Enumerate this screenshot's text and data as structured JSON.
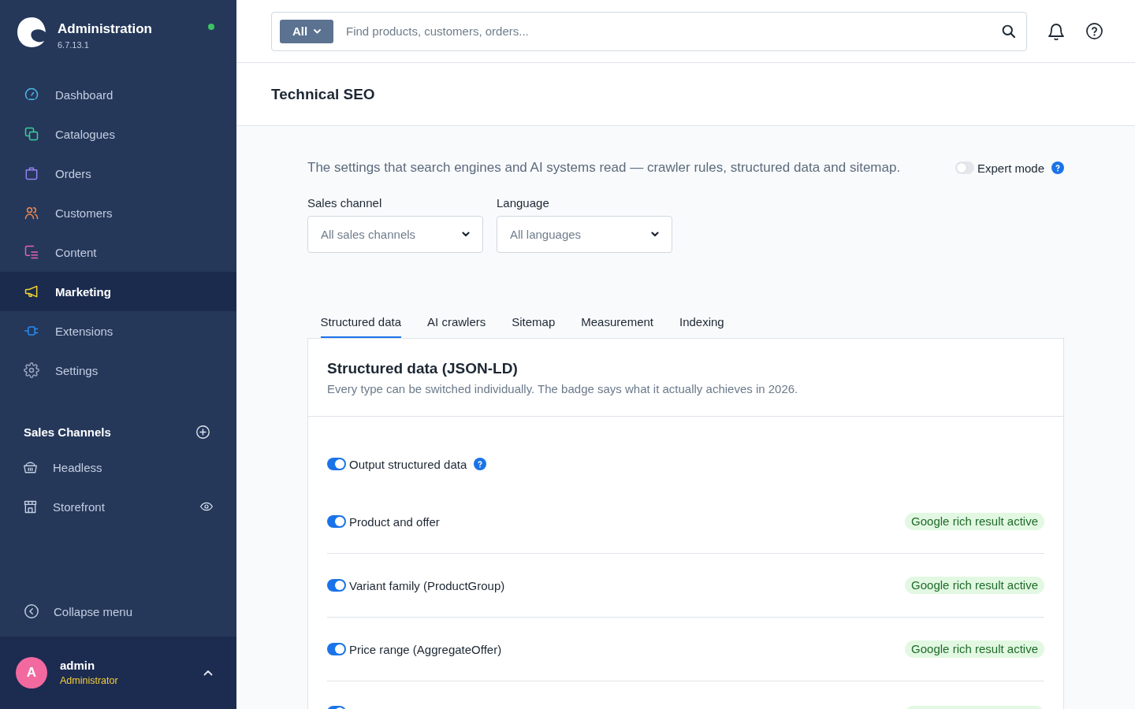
{
  "sidebar": {
    "app": {
      "title": "Administration",
      "version": "6.7.13.1",
      "online": true
    },
    "nav": [
      {
        "label": "Dashboard",
        "color": "#4db8e8",
        "selected": false
      },
      {
        "label": "Catalogues",
        "color": "#3ccf9a",
        "selected": false
      },
      {
        "label": "Orders",
        "color": "#9382f0",
        "selected": false
      },
      {
        "label": "Customers",
        "color": "#f2884b",
        "selected": false
      },
      {
        "label": "Content",
        "color": "#e860b4",
        "selected": false
      },
      {
        "label": "Marketing",
        "color": "#f2d230",
        "selected": true
      },
      {
        "label": "Extensions",
        "color": "#2a8cf0",
        "selected": false
      },
      {
        "label": "Settings",
        "color": "#9aa6bd",
        "selected": false
      }
    ],
    "sales_channels": {
      "heading": "Sales Channels",
      "items": [
        {
          "label": "Headless",
          "preview": false
        },
        {
          "label": "Storefront",
          "preview": true
        }
      ]
    },
    "collapse": "Collapse menu",
    "user": {
      "initial": "A",
      "name": "admin",
      "role": "Administrator"
    }
  },
  "topbar": {
    "search": {
      "scope": "All",
      "placeholder": "Find products, customers, orders..."
    }
  },
  "page": {
    "title": "Technical SEO"
  },
  "intro": {
    "text": "The settings that search engines and AI systems read — crawler rules, structured data and sitemap.",
    "expert_mode": {
      "label": "Expert mode",
      "on": false
    }
  },
  "filters": [
    {
      "label": "Sales channel",
      "placeholder": "All sales channels"
    },
    {
      "label": "Language",
      "placeholder": "All languages"
    }
  ],
  "tabs": [
    {
      "label": "Structured data",
      "selected": true
    },
    {
      "label": "AI crawlers",
      "selected": false
    },
    {
      "label": "Sitemap",
      "selected": false
    },
    {
      "label": "Measurement",
      "selected": false
    },
    {
      "label": "Indexing",
      "selected": false
    }
  ],
  "card": {
    "title": "Structured data (JSON-LD)",
    "subtitle": "Every type can be switched individually. The badge says what it actually achieves in 2026.",
    "rows": [
      {
        "kind": "master",
        "label": "Output structured data",
        "on": true,
        "help": true
      },
      {
        "kind": "type",
        "label": "Product and offer",
        "on": true,
        "badge": "Google rich result active"
      },
      {
        "kind": "type",
        "label": "Variant family (ProductGroup)",
        "on": true,
        "badge": "Google rich result active"
      },
      {
        "kind": "type",
        "label": "Price range (AggregateOffer)",
        "on": true,
        "badge": "Google rich result active"
      },
      {
        "kind": "cut",
        "on": true
      }
    ]
  }
}
